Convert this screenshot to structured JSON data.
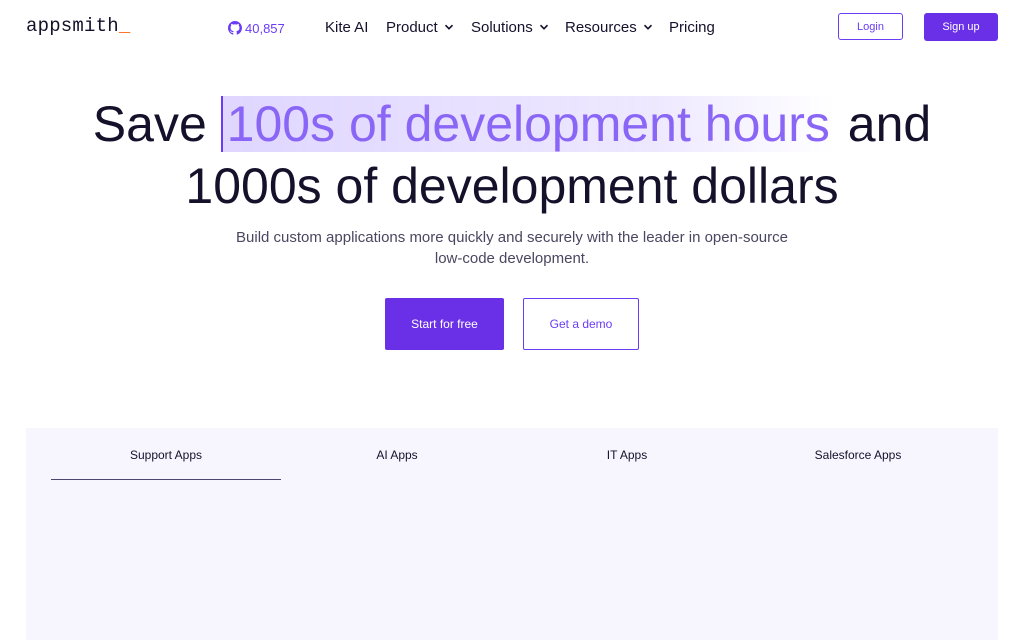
{
  "nav": {
    "logo_text": "appsmith",
    "logo_cursor": "_",
    "github_stars": "40,857",
    "items": [
      {
        "label": "Kite AI",
        "dropdown": false
      },
      {
        "label": "Product",
        "dropdown": true
      },
      {
        "label": "Solutions",
        "dropdown": true
      },
      {
        "label": "Resources",
        "dropdown": true
      },
      {
        "label": "Pricing",
        "dropdown": false
      }
    ],
    "login_label": "Login",
    "signup_label": "Sign up"
  },
  "hero": {
    "line1_pre": "Save",
    "line1_highlight": "100s of development hours",
    "line1_post": "and",
    "line2": "1000s of development dollars",
    "subtitle": "Build custom applications more quickly and securely with the leader in open-source low-code development.",
    "cta_primary": "Start for free",
    "cta_secondary": "Get a demo"
  },
  "tabs": [
    {
      "label": "Support Apps",
      "active": true
    },
    {
      "label": "AI Apps",
      "active": false
    },
    {
      "label": "IT Apps",
      "active": false
    },
    {
      "label": "Salesforce Apps",
      "active": false
    }
  ],
  "colors": {
    "brand": "#6a30e8",
    "accent_text": "#6a3df5",
    "highlight_text": "#8a66f7",
    "heading": "#15112b",
    "panel_bg": "#f7f5fe"
  }
}
